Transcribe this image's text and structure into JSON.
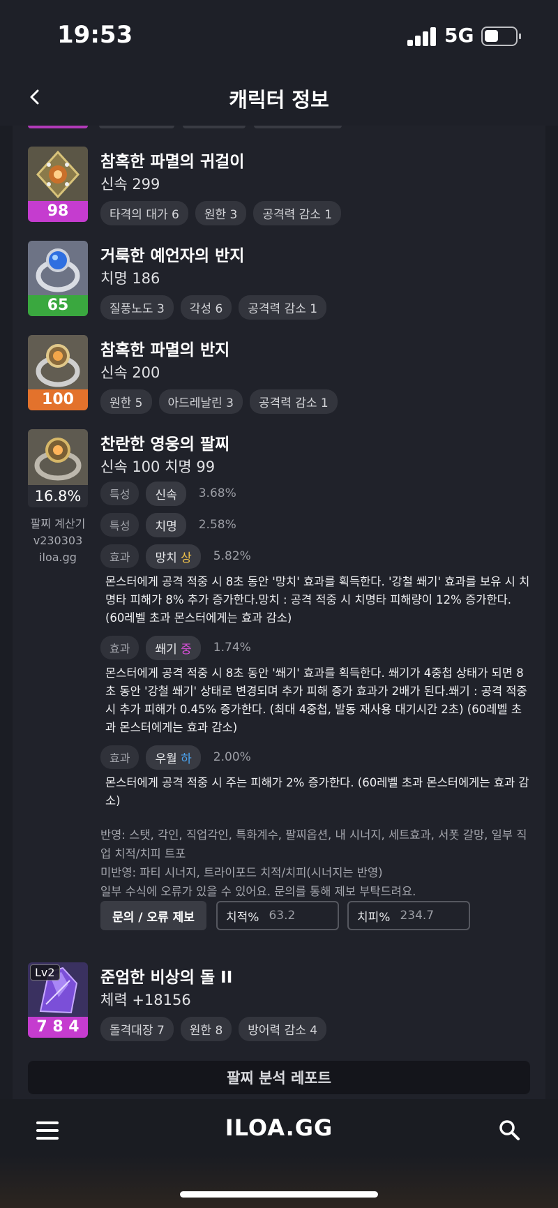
{
  "status": {
    "time": "19:53",
    "network": "5G",
    "battery_level": 0.45
  },
  "header": {
    "title": "캐릭터 정보"
  },
  "items": [
    {
      "name": "참혹한 파멸의 귀걸이",
      "stat": "신속 299",
      "quality": "98",
      "quality_color": "#c53ccf",
      "tags": [
        "타격의 대가 6",
        "원한 3",
        "공격력 감소 1"
      ]
    },
    {
      "name": "거룩한 예언자의 반지",
      "stat": "치명 186",
      "quality": "65",
      "quality_color": "#3aa83f",
      "tags": [
        "질풍노도 3",
        "각성 6",
        "공격력 감소 1"
      ]
    },
    {
      "name": "참혹한 파멸의 반지",
      "stat": "신속 200",
      "quality": "100",
      "quality_color": "#e3722c",
      "tags": [
        "원한 5",
        "아드레날린 3",
        "공격력 감소 1"
      ]
    }
  ],
  "bracelet": {
    "name": "찬란한 영웅의 팔찌",
    "stat": "신속 100  치명 99",
    "percent": "16.8%",
    "calc_label": [
      "팔찌 계산기",
      "v230303",
      "iloa.gg"
    ],
    "rows": [
      {
        "type": "특성",
        "name": "신속",
        "grade": "",
        "value": "3.68%"
      },
      {
        "type": "특성",
        "name": "치명",
        "grade": "",
        "value": "2.58%"
      },
      {
        "type": "효과",
        "name": "망치",
        "grade": "상",
        "value": "5.82%",
        "desc": "몬스터에게 공격 적중 시 8초 동안 '망치' 효과를 획득한다. '강철 쐐기' 효과를 보유 시 치명타 피해가 8% 추가 증가한다.망치 : 공격 적중 시 치명타 피해량이 12% 증가한다. (60레벨 초과 몬스터에게는 효과 감소)"
      },
      {
        "type": "효과",
        "name": "쐐기",
        "grade": "중",
        "value": "1.74%",
        "desc": "몬스터에게 공격 적중 시 8초 동안 '쐐기' 효과를 획득한다. 쐐기가 4중첩 상태가 되면 8초 동안 '강철 쐐기' 상태로 변경되며 추가 피해 증가 효과가 2배가 된다.쐐기 : 공격 적중 시 추가 피해가 0.45% 증가한다. (최대 4중첩, 발동 재사용 대기시간 2초) (60레벨 초과 몬스터에게는 효과 감소)"
      },
      {
        "type": "효과",
        "name": "우월",
        "grade": "하",
        "value": "2.00%",
        "desc": "몬스터에게 공격 적중 시 주는 피해가 2% 증가한다. (60레벨 초과 몬스터에게는 효과 감소)"
      }
    ],
    "notes": [
      "반영: 스탯, 각인, 직업각인, 특화계수, 팔찌옵션, 내 시너지, 세트효과, 서폿 갈망, 일부 직업 치적/치피 트포",
      "미반영: 파티 시너지, 트라이포드 치적/치피(시너지는 반영)",
      "일부 수식에 오류가 있을 수 있어요. 문의를 통해 제보 부탁드려요."
    ],
    "report_button": "문의 / 오류 제보",
    "crit_rate_label": "치적%",
    "crit_rate_value": "63.2",
    "crit_dmg_label": "치피%",
    "crit_dmg_value": "234.7"
  },
  "stone": {
    "name": "준엄한 비상의 돌 II",
    "stat": "체력 +18156",
    "level": "Lv2",
    "quality": "7 8 4",
    "quality_color": "#c53ccf",
    "tags": [
      "돌격대장 7",
      "원한 8",
      "방어력 감소 4"
    ]
  },
  "analysis_button": "팔찌 분석 레포트",
  "nav": {
    "logo": "ILOA.GG"
  }
}
